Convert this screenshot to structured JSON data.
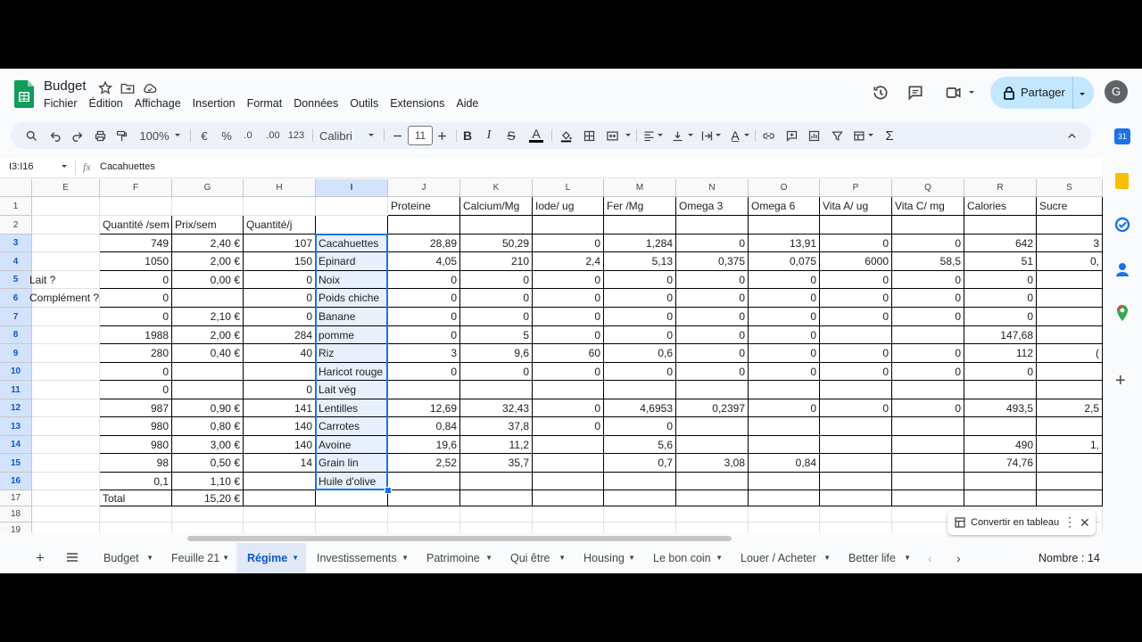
{
  "app": {
    "title": "Budget",
    "menus": [
      "Fichier",
      "Édition",
      "Affichage",
      "Insertion",
      "Format",
      "Données",
      "Outils",
      "Extensions",
      "Aide"
    ],
    "share_label": "Partager",
    "avatar_initial": "G"
  },
  "toolbar": {
    "zoom": "100%",
    "currency": "€",
    "percent": "%",
    "dec_less": ".0",
    "dec_more": ".00",
    "num_format": "123",
    "font": "Calibri",
    "font_size": "11"
  },
  "formula_bar": {
    "name_box": "I3:I16",
    "fx": "fx",
    "content": "Cacahuettes"
  },
  "columns": [
    "E",
    "F",
    "G",
    "H",
    "I",
    "J",
    "K",
    "L",
    "M",
    "N",
    "O",
    "P",
    "Q",
    "R",
    "S"
  ],
  "selected_column": "I",
  "row_numbers": [
    "1",
    "2",
    "3",
    "4",
    "5",
    "6",
    "7",
    "8",
    "9",
    "10",
    "11",
    "12",
    "13",
    "14",
    "15",
    "16",
    "17",
    "18",
    "19"
  ],
  "rows": [
    [
      "",
      "",
      "",
      "",
      "",
      "Proteine",
      "Calcium/Mg",
      "Iode/ ug",
      "Fer /Mg",
      "Omega 3",
      "Omega 6",
      "Vita A/ ug",
      "Vita C/ mg",
      "Calories",
      "Sucre"
    ],
    [
      "",
      "Quantité /sem",
      "Prix/sem",
      "Quantité/j",
      "",
      "",
      "",
      "",
      "",
      "",
      "",
      "",
      "",
      "",
      ""
    ],
    [
      "",
      "749",
      "2,40 €",
      "107",
      "Cacahuettes",
      "28,89",
      "50,29",
      "0",
      "1,284",
      "0",
      "13,91",
      "0",
      "0",
      "642",
      "3"
    ],
    [
      "",
      "1050",
      "2,00 €",
      "150",
      "Epinard",
      "4,05",
      "210",
      "2,4",
      "5,13",
      "0,375",
      "0,075",
      "6000",
      "58,5",
      "51",
      "0,"
    ],
    [
      "Lait ?",
      "0",
      "0,00 €",
      "0",
      "Noix",
      "0",
      "0",
      "0",
      "0",
      "0",
      "0",
      "0",
      "0",
      "0",
      ""
    ],
    [
      "Complément ?",
      "0",
      "",
      "0",
      "Poids chiche",
      "0",
      "0",
      "0",
      "0",
      "0",
      "0",
      "0",
      "0",
      "0",
      ""
    ],
    [
      "",
      "0",
      "2,10 €",
      "0",
      "Banane",
      "0",
      "0",
      "0",
      "0",
      "0",
      "0",
      "0",
      "0",
      "0",
      ""
    ],
    [
      "",
      "1988",
      "2,00 €",
      "284",
      "pomme",
      "0",
      "5",
      "0",
      "0",
      "0",
      "0",
      "",
      "",
      "147,68",
      ""
    ],
    [
      "",
      "280",
      "0,40 €",
      "40",
      "Riz",
      "3",
      "9,6",
      "60",
      "0,6",
      "0",
      "0",
      "0",
      "0",
      "112",
      "("
    ],
    [
      "",
      "0",
      "",
      "",
      "Haricot rouge",
      "0",
      "0",
      "0",
      "0",
      "0",
      "0",
      "0",
      "0",
      "0",
      ""
    ],
    [
      "",
      "0",
      "",
      "0",
      "Lait vég",
      "",
      "",
      "",
      "",
      "",
      "",
      "",
      "",
      "",
      ""
    ],
    [
      "",
      "987",
      "0,90 €",
      "141",
      "Lentilles",
      "12,69",
      "32,43",
      "0",
      "4,6953",
      "0,2397",
      "0",
      "0",
      "0",
      "493,5",
      "2,5"
    ],
    [
      "",
      "980",
      "0,80 €",
      "140",
      "Carrotes",
      "0,84",
      "37,8",
      "0",
      "0",
      "",
      "",
      "",
      "",
      "",
      ""
    ],
    [
      "",
      "980",
      "3,00 €",
      "140",
      "Avoine",
      "19,6",
      "11,2",
      "",
      "5,6",
      "",
      "",
      "",
      "",
      "490",
      "1,"
    ],
    [
      "",
      "98",
      "0,50 €",
      "14",
      "Grain lin",
      "2,52",
      "35,7",
      "",
      "0,7",
      "3,08",
      "0,84",
      "",
      "",
      "74,76",
      ""
    ],
    [
      "",
      "0,1",
      "1,10 €",
      "",
      "Huile d'olive",
      "",
      "",
      "",
      "",
      "",
      "",
      "",
      "",
      "",
      ""
    ],
    [
      "",
      "Total",
      "15,20 €",
      "",
      "",
      "",
      "",
      "",
      "",
      "",
      "",
      "",
      "",
      "",
      ""
    ],
    [
      "",
      "",
      "",
      "",
      "",
      "",
      "",
      "",
      "",
      "",
      "",
      "",
      "",
      "",
      ""
    ],
    [
      "",
      "",
      "",
      "",
      "",
      "",
      "",
      "",
      "",
      "",
      "",
      "",
      "",
      "",
      ""
    ]
  ],
  "sheet_tabs": [
    "Budget",
    "Feuille 21",
    "Régime",
    "Investissements",
    "Patrimoine",
    "Qui être",
    "Housing",
    "Le bon coin",
    "Louer / Acheter",
    "Better life"
  ],
  "active_tab": "Régime",
  "status": "Nombre : 14",
  "convert_popup": "Convertir en tableau"
}
